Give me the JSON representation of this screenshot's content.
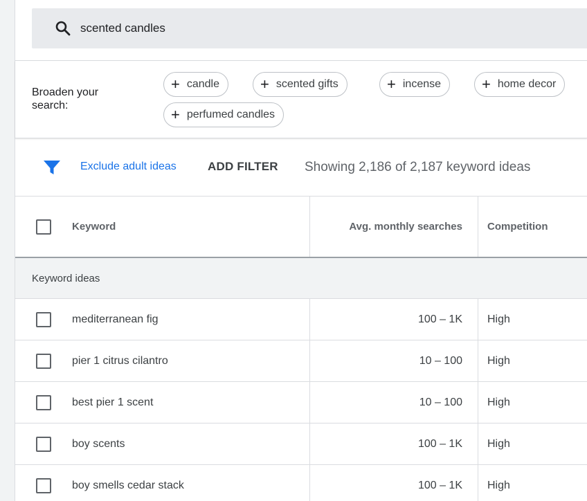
{
  "search": {
    "query": "scented candles",
    "icon": "search-icon"
  },
  "broaden": {
    "label": "Broaden your search:",
    "chips": [
      "candle",
      "scented gifts",
      "incense",
      "home decor",
      "perfumed candles"
    ]
  },
  "filter": {
    "icon": "filter-icon",
    "exclude_label": "Exclude adult ideas",
    "add_filter_label": "ADD FILTER",
    "count_text": "Showing 2,186 of 2,187 keyword ideas",
    "accent": "#1a73e8"
  },
  "table": {
    "headers": {
      "keyword": "Keyword",
      "searches": "Avg. monthly searches",
      "competition": "Competition"
    },
    "group_label": "Keyword ideas",
    "rows": [
      {
        "keyword": "mediterranean fig",
        "searches": "100 – 1K",
        "competition": "High"
      },
      {
        "keyword": "pier 1 citrus cilantro",
        "searches": "10 – 100",
        "competition": "High"
      },
      {
        "keyword": "best pier 1 scent",
        "searches": "10 – 100",
        "competition": "High"
      },
      {
        "keyword": "boy scents",
        "searches": "100 – 1K",
        "competition": "High"
      },
      {
        "keyword": "boy smells cedar stack",
        "searches": "100 – 1K",
        "competition": "High"
      }
    ]
  }
}
